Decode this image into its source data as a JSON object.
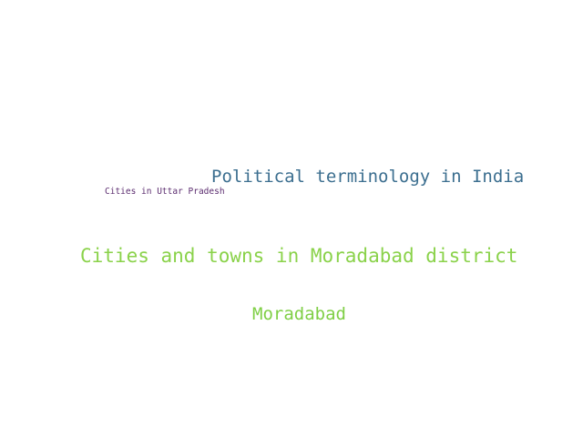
{
  "word_cloud": {
    "words": [
      {
        "text": "Political terminology in India",
        "color": "#3b6e8f"
      },
      {
        "text": "Cities in Uttar Pradesh",
        "color": "#5b2c6f"
      },
      {
        "text": "Cities and towns in Moradabad district",
        "color": "#8ad24a"
      },
      {
        "text": "Moradabad",
        "color": "#7fcf45"
      }
    ]
  }
}
